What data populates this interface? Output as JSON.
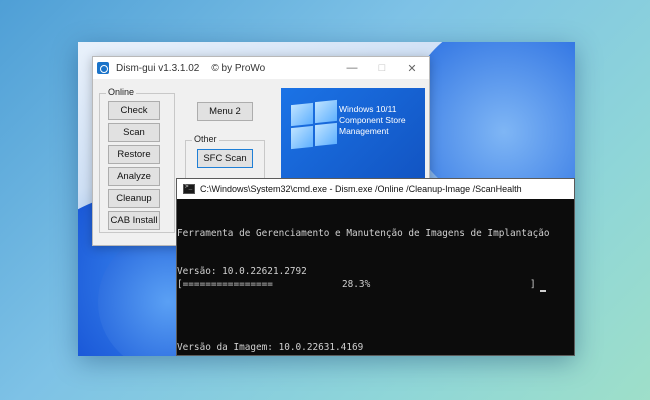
{
  "gui": {
    "title": "Dism-gui v1.3.1.02",
    "author": "© by ProWo",
    "minimize_icon": "—",
    "maximize_icon": "□",
    "close_icon": "✕",
    "online_group": "Online",
    "online_buttons": [
      "Check",
      "Scan",
      "Restore",
      "Analyze",
      "Cleanup",
      "CAB Install"
    ],
    "menu2_label": "Menu 2",
    "other_group": "Other",
    "sfc_label": "SFC Scan",
    "banner_line1": "Windows 10/11",
    "banner_line2": "Component Store",
    "banner_line3": "Management"
  },
  "cmd": {
    "title": "C:\\Windows\\System32\\cmd.exe - Dism.exe  /Online /Cleanup-Image /ScanHealth",
    "line1": "Ferramenta de Gerenciamento e Manutenção de Imagens de Implantação",
    "line2": "Versão: 10.0.22621.2792",
    "line3": "",
    "line4": "Versão da Imagem: 10.0.22631.4169",
    "progress_bar": "[================",
    "progress_percent": "28.3%",
    "progress_end": "]",
    "progress_value": 28.3
  },
  "colors": {
    "accent": "#1f7fd6",
    "banner": "#1b73e6",
    "terminal_bg": "#0c0c0c",
    "terminal_text": "#d0d0d0"
  }
}
